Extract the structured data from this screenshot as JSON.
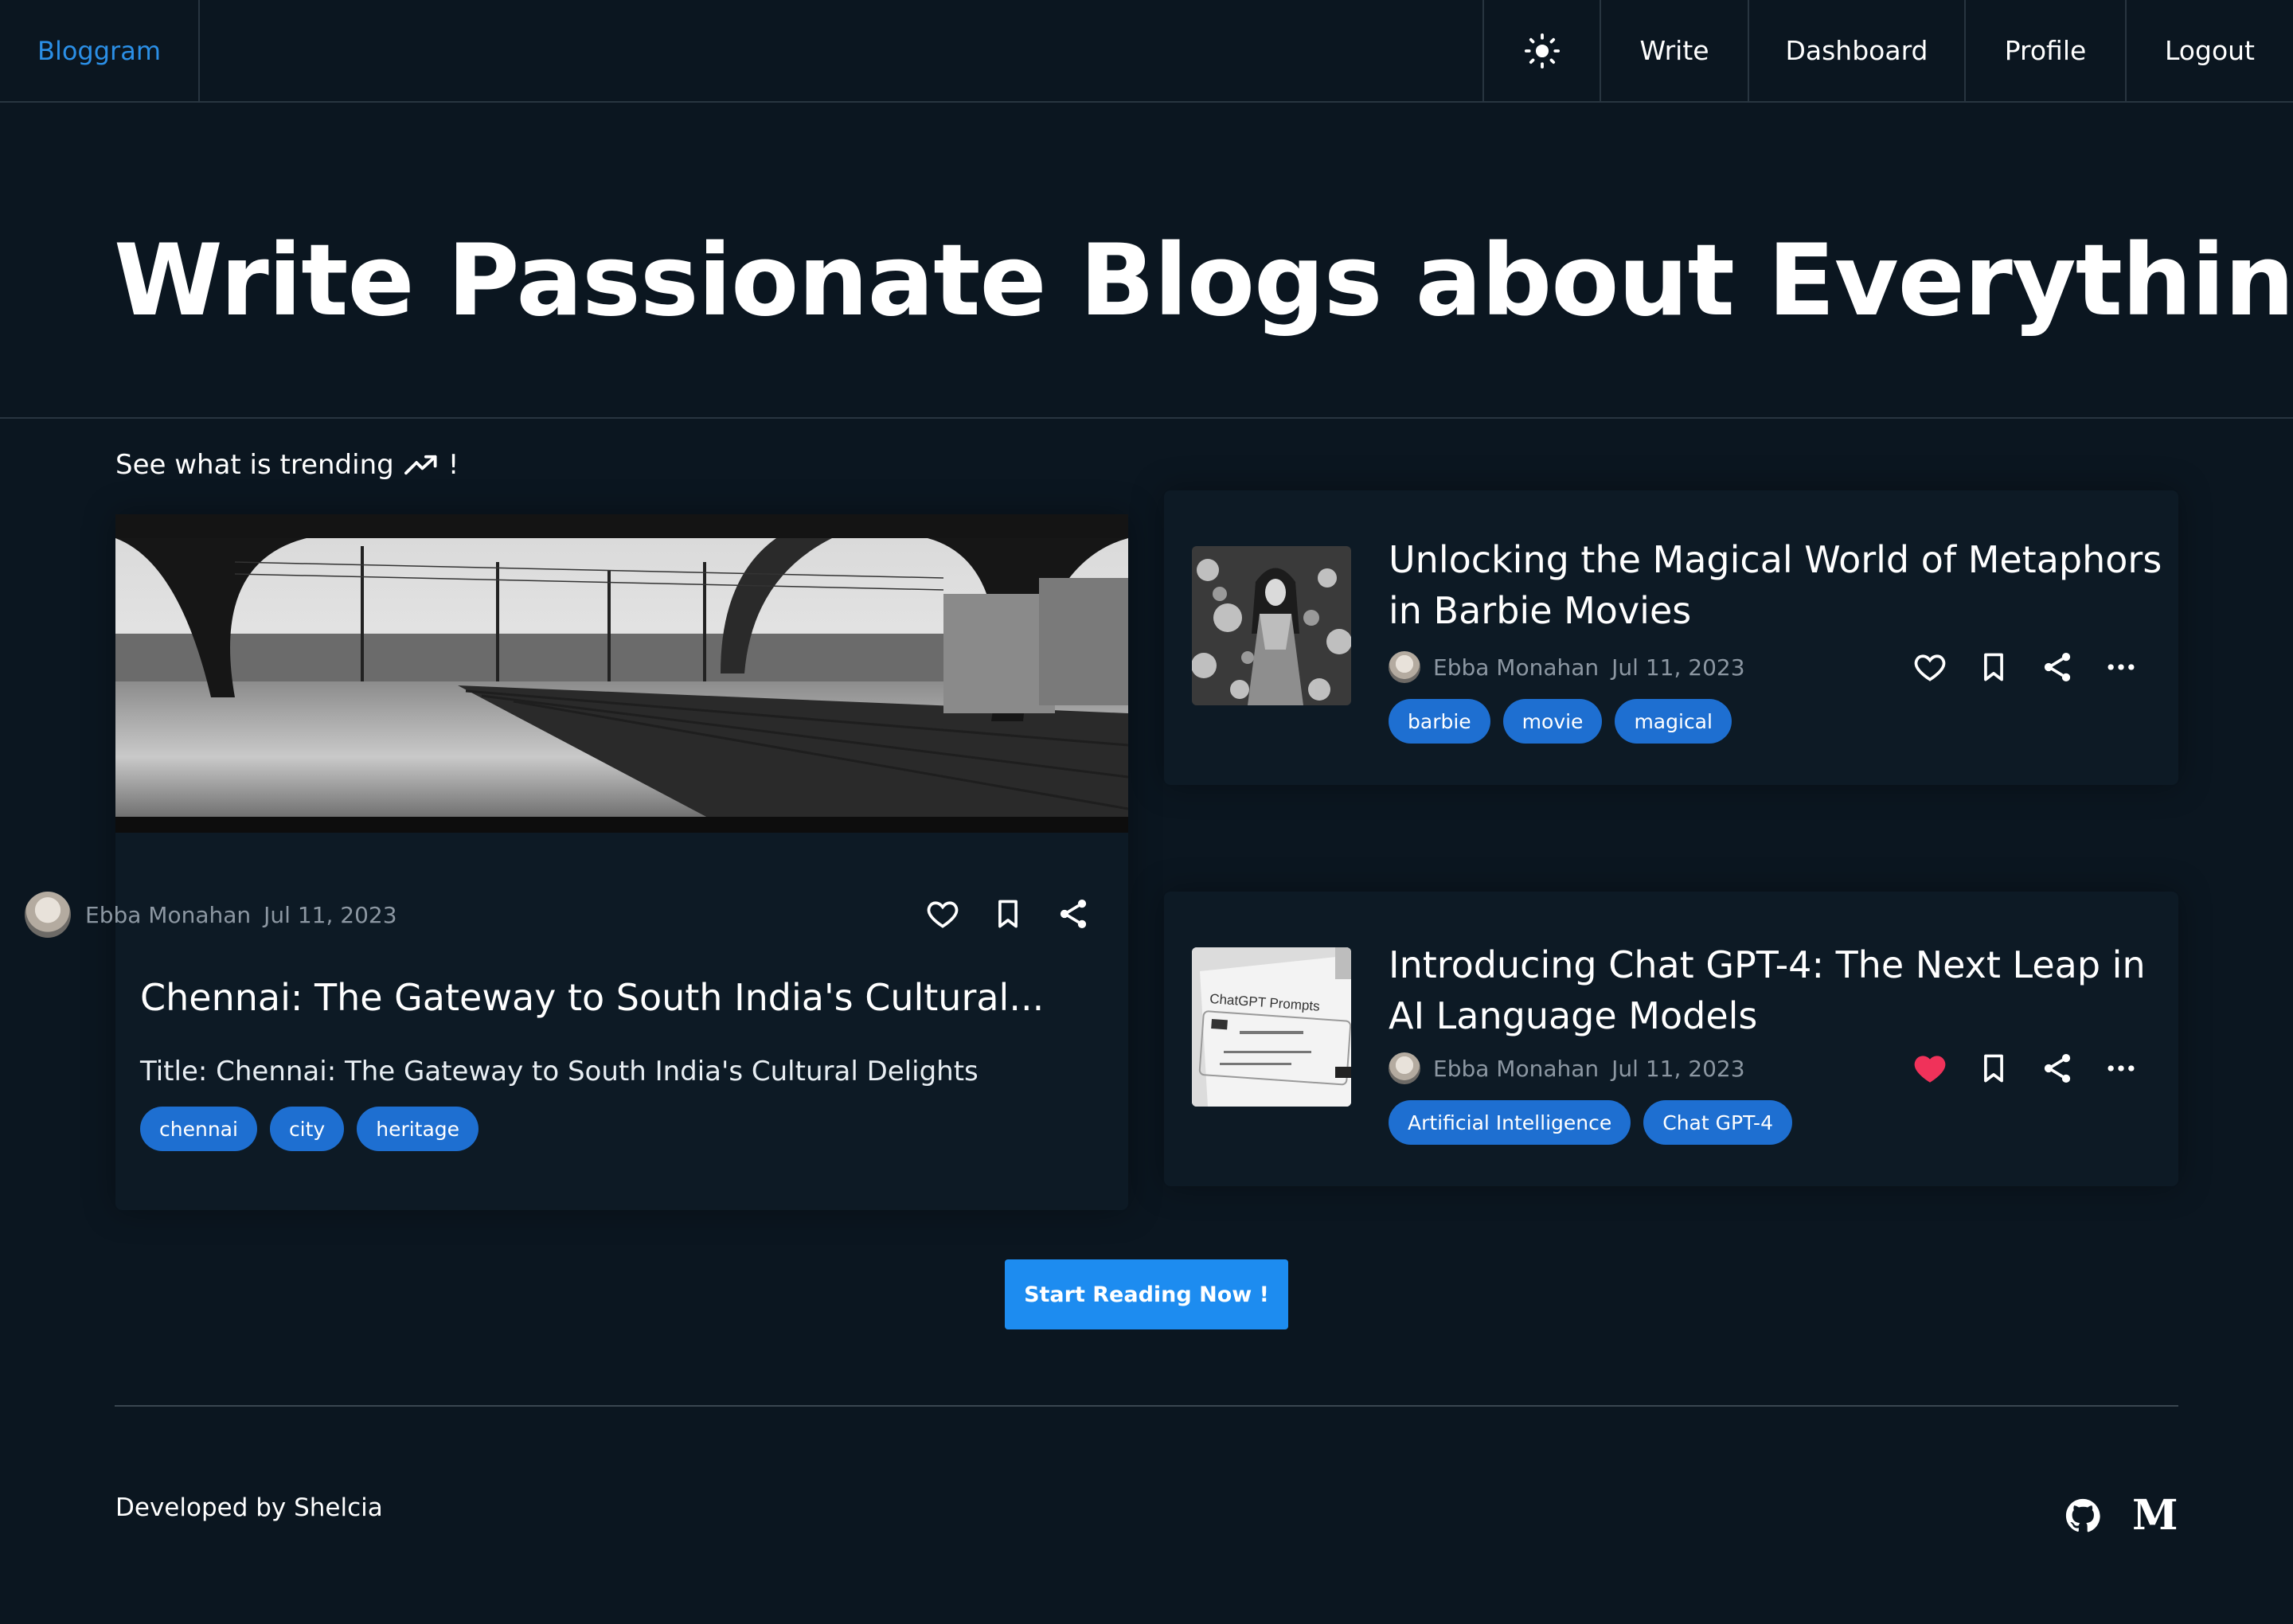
{
  "nav": {
    "brand": "Bloggram",
    "theme_icon": "sun-icon",
    "write": "Write",
    "dashboard": "Dashboard",
    "profile": "Profile",
    "logout": "Logout"
  },
  "hero": {
    "title": "Write Passionate Blogs about Everything"
  },
  "trending": {
    "label": "See what is trending",
    "suffix": "!",
    "icon": "trending-up-icon"
  },
  "featured": {
    "author": "Ebba Monahan",
    "date": "Jul 11, 2023",
    "title": "Chennai: The Gateway to South India's Cultural...",
    "excerpt": "Title: Chennai: The Gateway to South India's Cultural Delights",
    "tags": [
      "chennai",
      "city",
      "heritage"
    ],
    "liked": false
  },
  "side_posts": [
    {
      "title": "Unlocking the Magical World of Metaphors in Barbie Movies",
      "author": "Ebba Monahan",
      "date": "Jul 11, 2023",
      "tags": [
        "barbie",
        "movie",
        "magical"
      ],
      "liked": false
    },
    {
      "title": "Introducing Chat GPT-4: The Next Leap in AI Language Models",
      "author": "Ebba Monahan",
      "date": "Jul 11, 2023",
      "tags": [
        "Artificial Intelligence",
        "Chat GPT-4"
      ],
      "liked": true,
      "thumb_text": "ChatGPT Prompts"
    }
  ],
  "cta": "Start Reading Now !",
  "footer": {
    "credit": "Developed by Shelcia",
    "icons": [
      "github-icon",
      "medium-icon"
    ],
    "medium_letter": "M"
  },
  "colors": {
    "background": "#0b1620",
    "brand": "#2b8fe6",
    "tag": "#1e6fd1",
    "cta": "#1d8cf0",
    "liked": "#f0325a"
  }
}
